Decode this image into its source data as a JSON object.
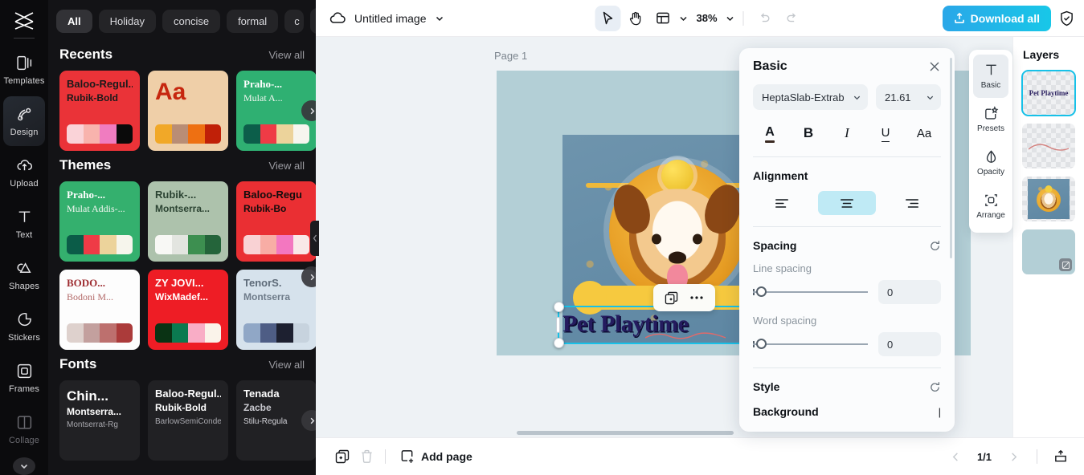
{
  "left_panel": {
    "filter_chips": [
      {
        "label": "All",
        "active": true
      },
      {
        "label": "Holiday",
        "active": false
      },
      {
        "label": "concise",
        "active": false
      },
      {
        "label": "formal",
        "active": false
      },
      {
        "label": "c",
        "active": false
      }
    ],
    "more_chip_icon": "chevron-down-icon",
    "sections": [
      {
        "title": "Recents",
        "view_all": "View all",
        "cards": [
          {
            "t1": "Baloo-Regul...",
            "t2": "Rubik-Bold",
            "bg": "#ea3338",
            "c1": "#1a1a1a",
            "c2": "#1a1a1a",
            "swatches": [
              "#fad3d8",
              "#f8b3ad",
              "#f07cc0",
              "#0a0a0a"
            ]
          },
          {
            "t1": "Aa",
            "t2": "",
            "bg": "#efcfa8",
            "c1": "#c6270f",
            "c2": "#c6270f",
            "swatches": [
              "#f1a828",
              "#b98d75",
              "#ee7012",
              "#c02008"
            ]
          },
          {
            "t1": "Praho-...",
            "t2": "Mulat A...",
            "bg": "#2fb072",
            "c1": "#ffffff",
            "c2": "#f2f6f0",
            "swatches": [
              "#0c5e4a",
              "#ef3b46",
              "#ecd39b",
              "#f6f5ee"
            ]
          }
        ]
      },
      {
        "title": "Themes",
        "view_all": "View all",
        "cards": [
          {
            "t1": "Praho-...",
            "t2": "Mulat Addis-...",
            "bg": "#34b06e",
            "c1": "#ffffff",
            "c2": "#f3f6f1",
            "swatches": [
              "#0b5c48",
              "#ef3b46",
              "#ecd39b",
              "#f6f5ec"
            ]
          },
          {
            "t1": "Rubik-...",
            "t2": "Montserra...",
            "bg": "#adc2ac",
            "c1": "#2b4332",
            "c2": "#2b4332",
            "swatches": [
              "#f8f8f5",
              "#e3e5e0",
              "#3d8f50",
              "#24643a"
            ]
          },
          {
            "t1": "Baloo-Regu",
            "t2": "Rubik-Bo",
            "bg": "#ea2f33",
            "c1": "#120d0d",
            "c2": "#120d0d",
            "swatches": [
              "#f9d2d4",
              "#f8ada5",
              "#f377c0",
              "#f9e8e8"
            ]
          },
          {
            "t1": "BODO...",
            "t2": "Bodoni M...",
            "bg": "#fdfdfd",
            "c1": "#9e2d31",
            "c2": "#b36a69",
            "swatches": [
              "#ded1cd",
              "#c3a09e",
              "#bd706e",
              "#ab3b3a"
            ]
          },
          {
            "t1": "ZY JOVI...",
            "t2": "WixMadef...",
            "bg": "#ee1d25",
            "c1": "#ffffff",
            "c2": "#ffffff",
            "swatches": [
              "#0a3314",
              "#0b7a50",
              "#f9adc6",
              "#faf3ea"
            ]
          },
          {
            "t1": "TenorS.",
            "t2": "Montserra",
            "bg": "#d6e2ec",
            "c1": "#5d6a78",
            "c2": "#6e7b89",
            "swatches": [
              "#90a7c6",
              "#4e5d85",
              "#1d2030",
              "#c7d3de"
            ]
          }
        ]
      },
      {
        "title": "Fonts",
        "view_all": "View all",
        "cards": [
          {
            "t1": "Chin...",
            "t2": "Montserra...",
            "t3": "Montserrat-Rg",
            "bg": "#212124",
            "c1": "#ffffff",
            "c2": "#ffffff",
            "c3": "#a8a8ae"
          },
          {
            "t1": "Baloo-Regul...",
            "t2": "Rubik-Bold",
            "t3": "BarlowSemiConden...",
            "bg": "#212124",
            "c1": "#ffffff",
            "c2": "#ffffff",
            "c3": "#a8a8ae"
          },
          {
            "t1": "Tenada",
            "t2": "Zacbe",
            "t3": "Stilu-Regula",
            "bg": "#212124",
            "c1": "#ffffff",
            "c2": "#c9c9cf",
            "c3": "#d4d4da"
          }
        ]
      }
    ]
  },
  "rail": {
    "logo_icon": "capcut-logo-icon",
    "items": [
      {
        "label": "Templates",
        "icon": "templates-icon",
        "active": false,
        "dim": false
      },
      {
        "label": "Design",
        "icon": "design-icon",
        "active": true,
        "dim": false
      },
      {
        "label": "Upload",
        "icon": "upload-cloud-icon",
        "active": false,
        "dim": false
      },
      {
        "label": "Text",
        "icon": "text-icon",
        "active": false,
        "dim": false
      },
      {
        "label": "Shapes",
        "icon": "shapes-icon",
        "active": false,
        "dim": false
      },
      {
        "label": "Stickers",
        "icon": "stickers-icon",
        "active": false,
        "dim": false
      },
      {
        "label": "Frames",
        "icon": "frames-icon",
        "active": false,
        "dim": false
      },
      {
        "label": "Collage",
        "icon": "collage-icon",
        "active": false,
        "dim": true
      }
    ],
    "expand_icon": "chevron-down-icon"
  },
  "topbar": {
    "cloud_icon": "cloud-icon",
    "doc_name": "Untitled image",
    "doc_caret_icon": "chevron-down-icon",
    "tools": [
      {
        "name": "select-tool",
        "icon": "cursor-arrow-icon",
        "active": true
      },
      {
        "name": "hand-tool",
        "icon": "hand-icon",
        "active": false
      },
      {
        "name": "layout-tool",
        "icon": "layout-icon",
        "active": false
      }
    ],
    "layout_caret_icon": "chevron-down-icon",
    "zoom": "38%",
    "zoom_caret_icon": "chevron-down-icon",
    "undo_icon": "undo-icon",
    "redo_icon": "redo-icon",
    "download_label": "Download all",
    "download_icon": "upload-arrow-icon",
    "download_color": "#1fb6e8",
    "shield_icon": "shield-check-icon"
  },
  "canvas": {
    "page_label": "Page 1",
    "artboard_bg": "#b3cfd6",
    "art_title": "Pet Playtime",
    "selection_color": "#17c1e8",
    "float_toolbar": [
      {
        "name": "duplicate-icon"
      },
      {
        "name": "more-options-icon"
      }
    ]
  },
  "properties": {
    "title": "Basic",
    "close_icon": "close-icon",
    "font_family": "HeptaSlab-Extrab",
    "font_size": "21.61",
    "format_buttons": [
      {
        "name": "text-color-button",
        "glyph": "A"
      },
      {
        "name": "bold-button",
        "glyph": "B"
      },
      {
        "name": "italic-button",
        "glyph": "I"
      },
      {
        "name": "underline-button",
        "glyph": "U"
      },
      {
        "name": "case-button",
        "glyph": "Aa"
      }
    ],
    "alignment_label": "Alignment",
    "alignments": [
      {
        "name": "align-left-button",
        "active": false
      },
      {
        "name": "align-center-button",
        "active": true
      },
      {
        "name": "align-right-button",
        "active": false
      }
    ],
    "spacing_label": "Spacing",
    "spacing_reset_icon": "reset-icon",
    "line_spacing_label": "Line spacing",
    "line_spacing_value": "0",
    "word_spacing_label": "Word spacing",
    "word_spacing_value": "0",
    "style_label": "Style",
    "style_reset_icon": "reset-icon",
    "background_label": "Background"
  },
  "right_tabs": [
    {
      "label": "Basic",
      "icon": "text-t-icon",
      "active": true
    },
    {
      "label": "Presets",
      "icon": "presets-icon",
      "active": false
    },
    {
      "label": "Opacity",
      "icon": "opacity-drop-icon",
      "active": false
    },
    {
      "label": "Arrange",
      "icon": "arrange-icon",
      "active": false
    }
  ],
  "layers": {
    "title": "Layers",
    "items": [
      {
        "name": "layer-text",
        "kind": "text",
        "text": "Pet Playtime",
        "selected": true
      },
      {
        "name": "layer-squiggle",
        "kind": "squiggle",
        "selected": false
      },
      {
        "name": "layer-image",
        "kind": "image",
        "selected": false
      },
      {
        "name": "layer-background",
        "kind": "background",
        "selected": false
      }
    ]
  },
  "bottom": {
    "duplicate_page_icon": "duplicate-page-icon",
    "delete_page_icon": "trash-icon",
    "add_page_label": "Add page",
    "add_page_icon": "add-page-icon",
    "prev_icon": "chevron-left-icon",
    "page_count": "1/1",
    "next_icon": "chevron-right-icon",
    "export_icon": "export-icon"
  }
}
